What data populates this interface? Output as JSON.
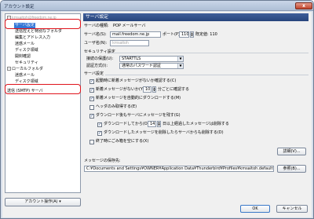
{
  "window": {
    "title": "アカウント設定",
    "close_label": "x"
  },
  "tree": {
    "account_name": "kmsaitoh@freedom.ne.jp",
    "account_toggle": "-",
    "items": [
      {
        "label": "サーバ設定",
        "selected": true
      },
      {
        "label": "送信控えと特別なフォルダ"
      },
      {
        "label": "編集とアドレス入力"
      },
      {
        "label": "迷惑メール"
      },
      {
        "label": "ディスク領域"
      },
      {
        "label": "開封確認"
      },
      {
        "label": "セキュリティ"
      }
    ],
    "local_folder": {
      "label": "ローカルフォルダ",
      "toggle": "-"
    },
    "local_items": [
      {
        "label": "迷惑メール"
      },
      {
        "label": "ディスク領域"
      }
    ],
    "smtp": {
      "label": "送信 (SMTP) サーバ"
    }
  },
  "account_actions_label": "アカウント操作(A) ▾",
  "panel": {
    "header": "サーバ設定",
    "server_type_label": "サーバの種類:",
    "server_type_value": "POP メールサーバ",
    "server_name_label": "サーバ名(S):",
    "server_name_value": "mail.freedom.ne.jp",
    "port_label": "ポート(P):",
    "port_value": "110",
    "port_default": "既定値: 110",
    "username_label": "ユーザ名(N):",
    "username_value": "kmsaitoh",
    "security_group": "セキュリティ設定",
    "connection_security_label": "接続の保護(U):",
    "connection_security_value": "STARTTLS",
    "auth_label": "認証方式(I):",
    "auth_value": "通常のパスワード認証",
    "server_group": "サーバ設定",
    "opt_check_startup": "起動時に新着メッセージがないか確認する(C)",
    "opt_check_every_pre": "新着メッセージがないか(Y)",
    "opt_check_every_value": "10",
    "opt_check_every_post": "分ごとに確認する",
    "opt_auto_download": "新着メッセージを自動的にダウンロードする(M)",
    "opt_headers_only": "ヘッダのみ取得する(E)",
    "opt_leave_on_server": "ダウンロード後もサーバにメッセージを残す(G)",
    "opt_delete_after_pre": "ダウンロードしてから(O)",
    "opt_delete_after_value": "14",
    "opt_delete_after_post": "日以上経過したメッセージは削除する",
    "opt_delete_when_deleted": "ダウンロードしたメッセージを削除したらサーバからも削除する(D)",
    "opt_empty_trash": "終了時にごみ箱を空にする(X)",
    "advanced_button": "詳細(V)...",
    "local_dir_label": "メッセージの保存先:",
    "local_dir_value": "C:¥Documents and Settings¥OWNER¥Application Data¥Thunderbird¥Profiles¥kmsaitoh.default¥Mail¥pop.",
    "browse_button": "参照(B)..."
  },
  "footer": {
    "ok": "OK",
    "cancel": "キャンセル"
  },
  "colors": {
    "highlight": "#e0141c",
    "selection": "#3376d6",
    "header": "#27457c"
  }
}
